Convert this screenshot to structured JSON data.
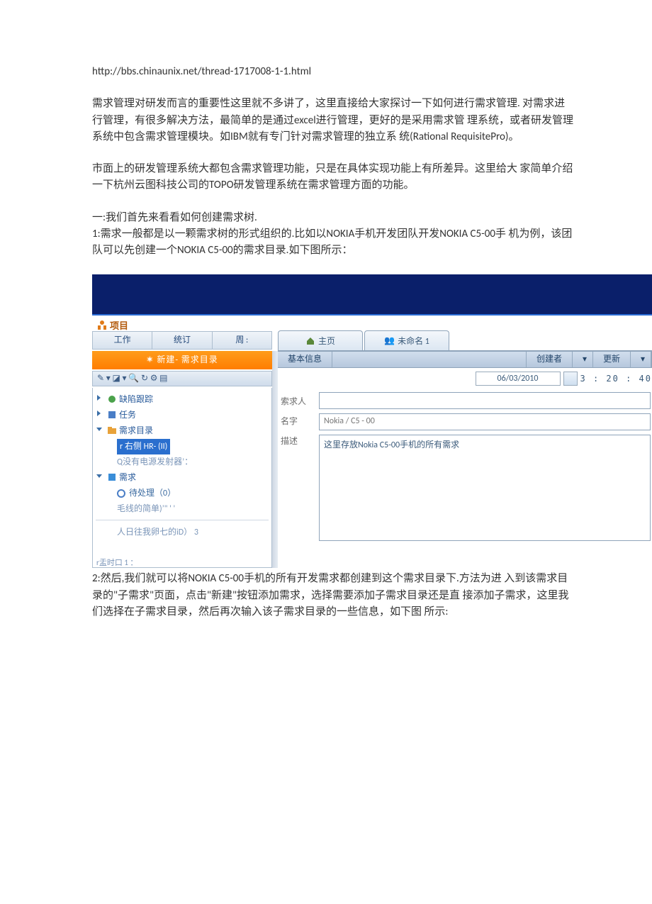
{
  "url": "http://bbs.chinaunix.net/thread-1717008-1-1.html",
  "para1": "需求管理对研发而言的重要性这里就不多讲了，这里直接给大家探讨一下如何进行需求管理. 对需求进行管理，有很多解决方法，最简单的是通过excel进行管理，更好的是采用需求管 理系统，或者研发管理系统中包含需求管理模块。如IBM就有专门针对需求管理的独立系 统(Rational RequisitePro)。",
  "para2": "市面上的研发管理系统大都包含需求管理功能，只是在具体实现功能上有所差异。这里给大 家简单介绍一下杭州云图科技公司的TOPO研发管理系统在需求管理方面的功能。",
  "para3a": "一:我们首先来看看如何创建需求树.",
  "para3b": "1:需求一般都是以一颗需求树的形式组织的.比如以NOKIA手机开发团队开发NOKIA C5-00手 机为例，该团队可以先创建一个NOKIA C5-00的需求目录.如下图所示：",
  "para4": "2:然后,我们就可以将NOKIA C5-00手机的所有开发需求都创建到这个需求目录下.方法为进 入到该需求目录的\"子需求\"页面，点击\"新建\"按钮添加需求，选择需要添加子需求目录还是直 接添加子需求，这里我们选择在子需求目录，然后再次输入该子需求目录的一些信息，如下图 所示:",
  "ui": {
    "project": "项目",
    "subtabs": [
      "工作",
      "统订",
      "周 :"
    ],
    "orange": "新建- 需求目录",
    "mini_icons": "✎ ▾  ◪ ▾  🔍  ↻  ⚙  ▤",
    "tree": {
      "n1": "缺陷跟踪",
      "n2": "任务",
      "n3": "需求目录",
      "n3_sub": "r 右侧  HR- (II)",
      "n3_sub2": "Q没有电源发射器’：",
      "n4": "需求",
      "n4_sub1": "待处理（0）",
      "n4_sub2": "毛线的简单)’\" ' '",
      "n4_sub3": "人日往我卵七的iD）    3"
    },
    "foot": "r盂时口  1 ：",
    "rtabs": {
      "home": "主页",
      "unnamed": "未命名 1"
    },
    "bar2": {
      "a": "基本信息",
      "b": "创建者",
      "c": "更新"
    },
    "date": "06/03/2010",
    "time": "3 : 20 : 40",
    "labels": {
      "owner": "索求人",
      "name": "名字",
      "desc": "描述"
    },
    "name_val": "Nokia / C5 - 00",
    "desc_val": "这里存放Nokia C5-00手机的所有需求"
  }
}
